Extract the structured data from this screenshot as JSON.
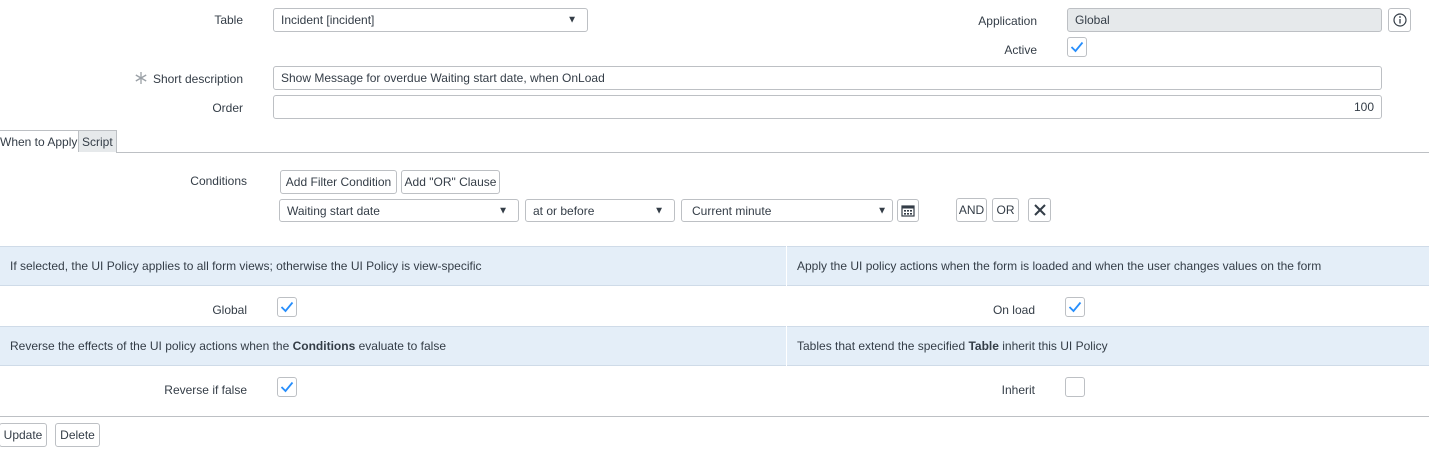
{
  "form": {
    "table_label": "Table",
    "table_value": "Incident [incident]",
    "application_label": "Application",
    "application_value": "Global",
    "active_label": "Active",
    "short_description_label": "Short description",
    "short_description_value": "Show Message for overdue Waiting start date, when OnLoad",
    "order_label": "Order",
    "order_value": "100"
  },
  "tabs": [
    {
      "label": "When to Apply"
    },
    {
      "label": "Script"
    }
  ],
  "conditions": {
    "label": "Conditions",
    "add_filter_label": "Add Filter Condition",
    "add_or_label": "Add \"OR\" Clause",
    "field_value": "Waiting start date",
    "operator_value": "at or before",
    "value_value": "Current minute",
    "and_label": "AND",
    "or_label": "OR"
  },
  "bands": {
    "global_help": "If selected, the UI Policy applies to all form views; otherwise the UI Policy is view-specific",
    "onload_help": "Apply the UI policy actions when the form is loaded and when the user changes values on the form",
    "reverse_help_pre": "Reverse the effects of the UI policy actions when the ",
    "reverse_help_bold": "Conditions",
    "reverse_help_post": " evaluate to false",
    "inherit_help_pre": "Tables that extend the specified ",
    "inherit_help_bold": "Table",
    "inherit_help_post": " inherit this UI Policy"
  },
  "checkboxes": {
    "global_label": "Global",
    "global_checked": true,
    "onload_label": "On load",
    "onload_checked": true,
    "reverse_label": "Reverse if false",
    "reverse_checked": true,
    "inherit_label": "Inherit",
    "inherit_checked": false,
    "active_checked": true
  },
  "actions": {
    "update_label": "Update",
    "delete_label": "Delete"
  },
  "icons": {
    "info": "info-icon",
    "calendar": "calendar-icon",
    "close": "close-icon",
    "check": "check-icon",
    "required": "asterisk-icon"
  },
  "colors": {
    "band_bg": "#e4eef8",
    "check": "#278efc"
  }
}
